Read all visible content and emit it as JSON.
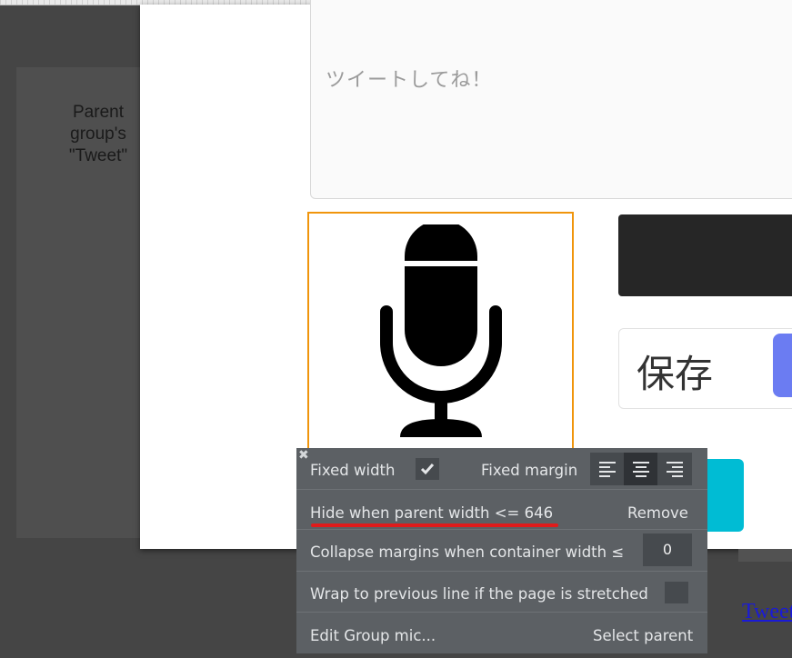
{
  "background_panel": {
    "text": "Parent\ngroup's\n\"Tweet\""
  },
  "canvas": {
    "tweet_placeholder": "ツイートしてね！",
    "save_label": "保存",
    "link_label": "Tweet"
  },
  "popup": {
    "close_icon": "close-icon",
    "fixed_width_label": "Fixed width",
    "fixed_width_checked": true,
    "fixed_margin_label": "Fixed margin",
    "alignment_options": [
      "left",
      "center",
      "right"
    ],
    "alignment_selected": "center",
    "hide_label": "Hide when parent width <= 646",
    "remove_label": "Remove",
    "collapse_label": "Collapse margins when container width ≤",
    "collapse_value": "0",
    "wrap_label": "Wrap to previous line if the page is stretched",
    "wrap_checked": false,
    "edit_group_label": "Edit Group mic...",
    "select_parent_label": "Select parent"
  },
  "colors": {
    "selection_border": "#f0950c",
    "popup_bg": "#5c6064",
    "highlight_underline": "#e01b1b",
    "cyan_button": "#00bcd4",
    "purple_tab": "#6b7cf2"
  }
}
